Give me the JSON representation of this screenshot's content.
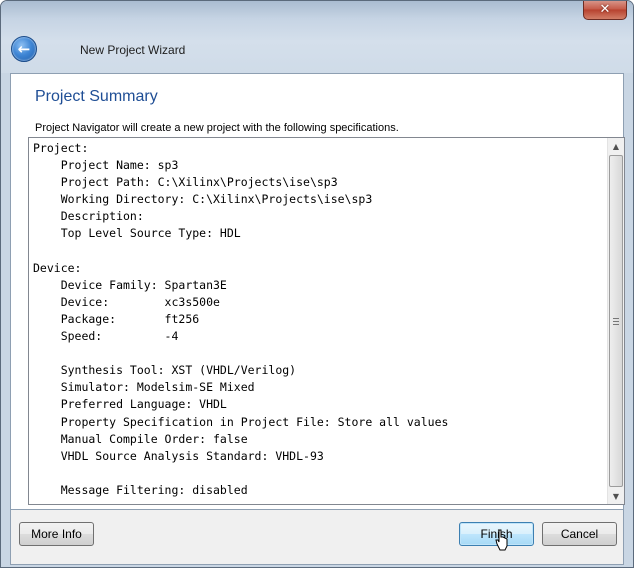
{
  "window": {
    "title": "New Project Wizard",
    "close_glyph": "✕",
    "back_glyph": "←"
  },
  "page": {
    "heading": "Project Summary",
    "intro": "Project Navigator will create a new project with the following specifications."
  },
  "summary": {
    "lines": [
      "Project:",
      "    Project Name: sp3",
      "    Project Path: C:\\Xilinx\\Projects\\ise\\sp3",
      "    Working Directory: C:\\Xilinx\\Projects\\ise\\sp3",
      "    Description:",
      "    Top Level Source Type: HDL",
      "",
      "Device:",
      "    Device Family: Spartan3E",
      "    Device:        xc3s500e",
      "    Package:       ft256",
      "    Speed:         -4",
      "",
      "    Synthesis Tool: XST (VHDL/Verilog)",
      "    Simulator: Modelsim-SE Mixed",
      "    Preferred Language: VHDL",
      "    Property Specification in Project File: Store all values",
      "    Manual Compile Order: false",
      "    VHDL Source Analysis Standard: VHDL-93",
      "",
      "    Message Filtering: disabled"
    ]
  },
  "buttons": {
    "more_info": "More Info",
    "finish": "Finish",
    "cancel": "Cancel"
  },
  "icons": {
    "back": "back-arrow-icon",
    "close": "close-icon",
    "scroll_up": "scroll-up-icon",
    "scroll_down": "scroll-down-icon",
    "cursor": "mouse-pointer-icon"
  },
  "colors": {
    "heading": "#1f4e95",
    "finish_highlight": "#bee6fd"
  }
}
